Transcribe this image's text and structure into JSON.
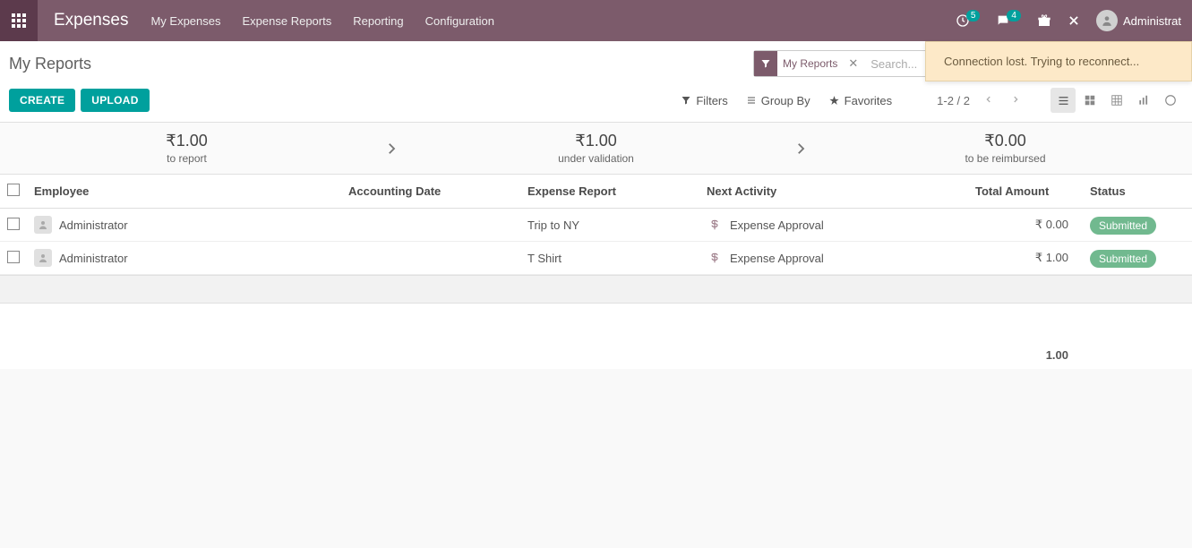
{
  "nav": {
    "brand": "Expenses",
    "items": [
      "My Expenses",
      "Expense Reports",
      "Reporting",
      "Configuration"
    ],
    "activities_badge": "5",
    "discuss_badge": "4",
    "user": "Administrat"
  },
  "toast": {
    "message": "Connection lost. Trying to reconnect..."
  },
  "control": {
    "breadcrumb": "My Reports",
    "facet_label": "My Reports",
    "search_placeholder": "Search...",
    "create_label": "CREATE",
    "upload_label": "UPLOAD",
    "filters_label": "Filters",
    "groupby_label": "Group By",
    "favorites_label": "Favorites",
    "pager": "1-2 / 2"
  },
  "summary": {
    "to_report_amount": "₹1.00",
    "to_report_label": "to report",
    "under_val_amount": "₹1.00",
    "under_val_label": "under validation",
    "reimb_amount": "₹0.00",
    "reimb_label": "to be reimbursed"
  },
  "table": {
    "headers": {
      "employee": "Employee",
      "accounting_date": "Accounting Date",
      "expense_report": "Expense Report",
      "next_activity": "Next Activity",
      "total_amount": "Total Amount",
      "status": "Status"
    },
    "rows": [
      {
        "employee": "Administrator",
        "accounting_date": "",
        "expense_report": "Trip to NY",
        "next_activity": "Expense Approval",
        "total_amount": "₹ 0.00",
        "status": "Submitted"
      },
      {
        "employee": "Administrator",
        "accounting_date": "",
        "expense_report": "T Shirt",
        "next_activity": "Expense Approval",
        "total_amount": "₹ 1.00",
        "status": "Submitted"
      }
    ],
    "footer_total": "1.00"
  }
}
